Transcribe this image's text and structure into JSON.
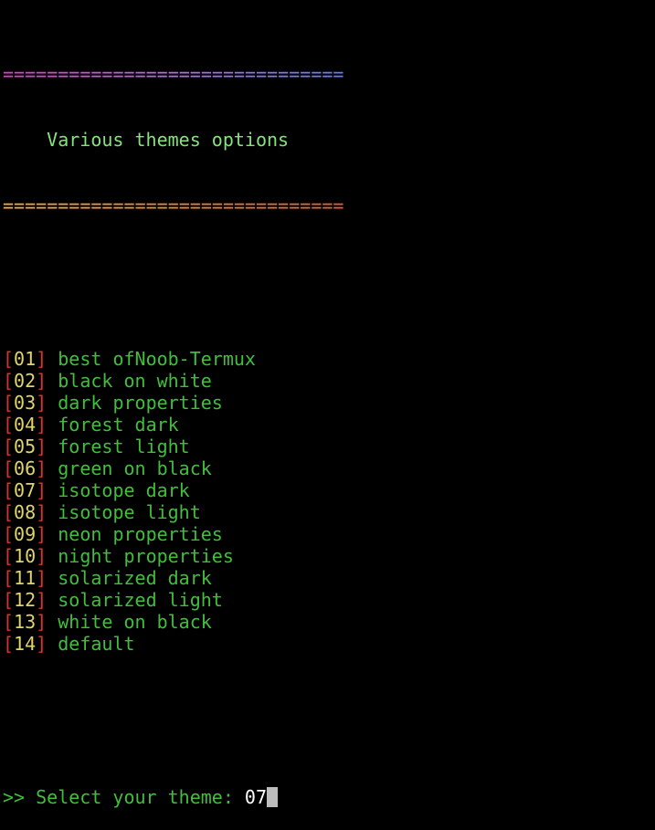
{
  "header": {
    "border_top": "===============================",
    "title": "    Various themes options",
    "border_bottom": "===============================",
    "colors": {
      "border_top_start": "#e040c8",
      "border_top_mid": "#b070e0",
      "border_top_end": "#6a7cf0",
      "border_bottom_start": "#f0b040",
      "border_bottom_end": "#e8603a",
      "title": "#86e27b"
    }
  },
  "menu": {
    "bracket_color": "#d9342a",
    "number_color": "#e0d46a",
    "label_color": "#3fbf3a",
    "items": [
      {
        "num": "01",
        "label": "best ofNoob-Termux"
      },
      {
        "num": "02",
        "label": "black on white"
      },
      {
        "num": "03",
        "label": "dark properties"
      },
      {
        "num": "04",
        "label": "forest dark"
      },
      {
        "num": "05",
        "label": "forest light"
      },
      {
        "num": "06",
        "label": "green on black"
      },
      {
        "num": "07",
        "label": "isotope dark"
      },
      {
        "num": "08",
        "label": "isotope light"
      },
      {
        "num": "09",
        "label": "neon properties"
      },
      {
        "num": "10",
        "label": "night properties"
      },
      {
        "num": "11",
        "label": "solarized dark"
      },
      {
        "num": "12",
        "label": "solarized light"
      },
      {
        "num": "13",
        "label": "white on black"
      },
      {
        "num": "14",
        "label": "default"
      }
    ]
  },
  "prompt": {
    "text": ">> Select your theme: ",
    "value": "07"
  }
}
